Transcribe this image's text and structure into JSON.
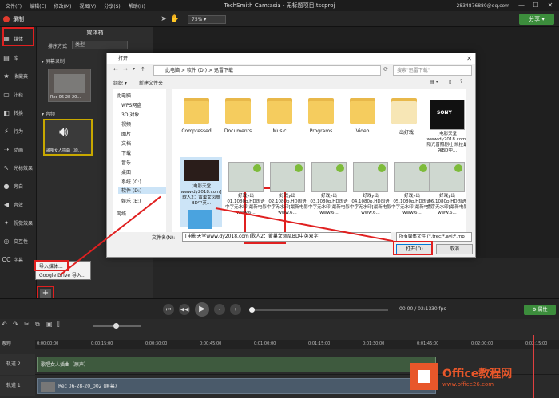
{
  "window": {
    "title": "TechSmith Camtasia - 无标题项目.tscproj",
    "menu": [
      "文件(F)",
      "编辑(E)",
      "修改(M)",
      "视图(V)",
      "分享(S)",
      "帮助(H)"
    ],
    "account": "2834876880@qq.com",
    "controls": [
      "—",
      "☐",
      "✕"
    ]
  },
  "toolbar": {
    "record_label": "录制",
    "zoom_value": "75%",
    "share_label": "分享"
  },
  "sidebar": {
    "items": [
      {
        "label": "媒体",
        "icon": "film-icon"
      },
      {
        "label": "库",
        "icon": "library-icon"
      },
      {
        "label": "收藏夹",
        "icon": "star-icon"
      },
      {
        "label": "注释",
        "icon": "annotation-icon"
      },
      {
        "label": "转换",
        "icon": "transition-icon"
      },
      {
        "label": "行为",
        "icon": "behavior-icon"
      },
      {
        "label": "动画",
        "icon": "animation-icon"
      },
      {
        "label": "光标效果",
        "icon": "cursor-icon"
      },
      {
        "label": "旁白",
        "icon": "mic-icon"
      },
      {
        "label": "音效",
        "icon": "audio-icon"
      },
      {
        "label": "视觉效果",
        "icon": "effects-icon"
      },
      {
        "label": "交互性",
        "icon": "interact-icon"
      },
      {
        "label": "字幕",
        "icon": "cc-icon"
      }
    ]
  },
  "bin": {
    "title": "媒体箱",
    "sort_label": "排序方式",
    "sort_value": "类型",
    "section_screen": "屏幕录制",
    "screen_clip": "Rec 06-28-20...",
    "section_audio": "音频",
    "audio_clip": "歌唱女人插曲（原..."
  },
  "dialog": {
    "title": "打开",
    "breadcrumb": [
      "此电脑",
      "软件 (D:)",
      "迅雷下载"
    ],
    "search_placeholder": "搜索\"迅雷下载\"",
    "organize": "组织 ▾",
    "new_folder": "新建文件夹",
    "nav": [
      "此电脑",
      "WPS网盘",
      "3D 对象",
      "视频",
      "图片",
      "文档",
      "下载",
      "音乐",
      "桌面",
      "系统 (C:)",
      "软件 (D:)",
      "娱乐 (E:)",
      "网络"
    ],
    "folders": [
      "Compressed",
      "Documents",
      "Music",
      "Programs",
      "Video",
      "一出好戏"
    ],
    "top_file": "[电影天堂www.dy2018.com]阳光普照剧社·凯拉最强BD中...",
    "files": [
      "[电影天堂www.dy2018.com]歌人2：黄巢女凤凰BD中英...",
      "好戏y出01.1080p.HD国语中字无水印[最新电影www.6...",
      "好戏y出02.1080p.HD国语中字无水印[最新电影www.6...",
      "好戏y出03.1080p.HD国语中字无水印[最新电影www.6...",
      "好戏y出04.1080p.HD国语中字无水印[最新电影www.6...",
      "好戏y出05.1080p.HD国语中字无水印[最新电影www.6...",
      "好戏y出06.1080p.HD国语中字无水印[最新电影www.6..."
    ],
    "filename_label": "文件名(N):",
    "filename_value": "[电影天堂www.dy2018.com]歌人2：黄巢女凤凰BD中英双字",
    "filetype_value": "所有媒体文件 (*.trec;*.avi;*.mp",
    "open_label": "打开(O)",
    "cancel_label": "取消"
  },
  "popup": {
    "import_media": "导入媒体...",
    "import_drive": "Google Drive 导入..."
  },
  "playback": {
    "timecode": "00:00 / 02:13",
    "fps": "30 fps",
    "props_label": "属性"
  },
  "timeline": {
    "ticks": [
      "0:00:00;00",
      "0:00:15;00",
      "0:00:30;00",
      "0:00:45;00",
      "0:01:00;00",
      "0:01:15;00",
      "0:01:30;00",
      "0:01:45;00",
      "0:02:00;00",
      "0:02:15;00"
    ],
    "tracks": [
      {
        "label": "轨道 2",
        "clip": "歌唱女人插曲（原声）"
      },
      {
        "label": "轨道 1",
        "clip": "Rec 06-28-20_002 (屏幕)"
      }
    ],
    "header_label": "跟踪"
  },
  "watermark": {
    "line1": "Office教程网",
    "line2": "www.office26.com"
  },
  "colors": {
    "accent_green": "#3c8d3c",
    "highlight_red": "#e02020",
    "record_red": "#e23b2e"
  }
}
